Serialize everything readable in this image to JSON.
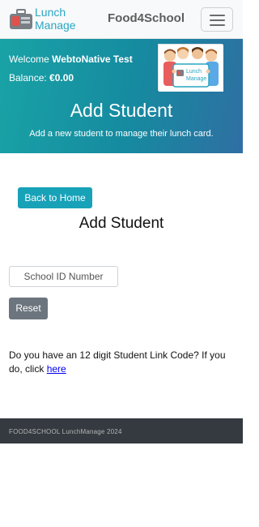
{
  "navbar": {
    "logo_line1": "Lunch",
    "logo_line2": "Manage",
    "brand": "Food4School"
  },
  "hero": {
    "welcome_prefix": "Welcome ",
    "user_name": "WebtoNative Test",
    "balance_label": "Balance: ",
    "balance_value": "€0.00",
    "title": "Add Student",
    "subtitle": "Add a new student to manage their lunch card."
  },
  "main": {
    "back_button": "Back to Home",
    "section_title": "Add Student",
    "school_id_placeholder": "School ID Number",
    "reset_button": "Reset",
    "link_code_text": "Do you have an 12 digit Student Link Code?  If you do, click ",
    "link_code_link": "here"
  },
  "footer": {
    "text": "FOOD4SCHOOL LunchManage 2024"
  },
  "colors": {
    "accent": "#17a2b8",
    "secondary": "#6c757d",
    "footer": "#343a40",
    "logo_text": "#2aa6c2"
  }
}
